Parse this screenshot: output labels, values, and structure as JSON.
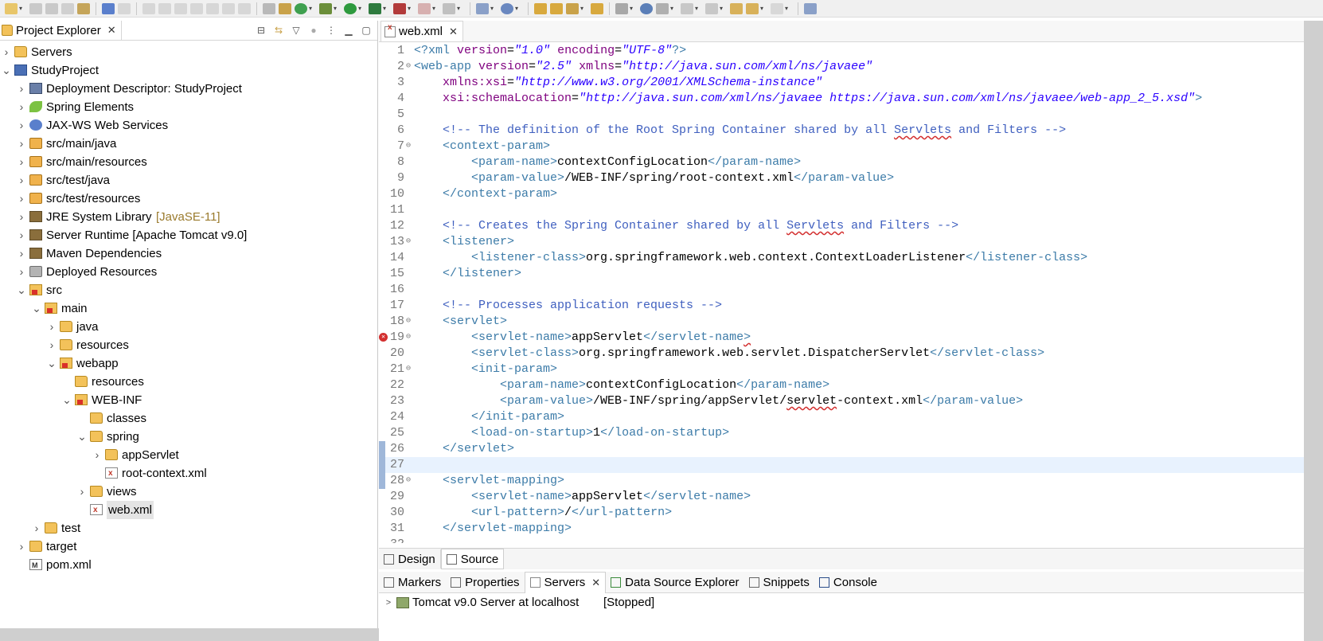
{
  "project_explorer": {
    "tab_label": "Project Explorer",
    "tree": [
      {
        "label": "Servers",
        "depth": 0,
        "twisty": "collapsed",
        "icon": "folder"
      },
      {
        "label": "StudyProject",
        "depth": 0,
        "twisty": "expanded",
        "icon": "project"
      },
      {
        "label": "Deployment Descriptor: StudyProject",
        "depth": 1,
        "twisty": "collapsed",
        "icon": "dd"
      },
      {
        "label": "Spring Elements",
        "depth": 1,
        "twisty": "collapsed",
        "icon": "leaf"
      },
      {
        "label": "JAX-WS Web Services",
        "depth": 1,
        "twisty": "collapsed",
        "icon": "ws"
      },
      {
        "label": "src/main/java",
        "depth": 1,
        "twisty": "collapsed",
        "icon": "pkgfolder"
      },
      {
        "label": "src/main/resources",
        "depth": 1,
        "twisty": "collapsed",
        "icon": "pkgfolder"
      },
      {
        "label": "src/test/java",
        "depth": 1,
        "twisty": "collapsed",
        "icon": "pkgfolder"
      },
      {
        "label": "src/test/resources",
        "depth": 1,
        "twisty": "collapsed",
        "icon": "pkgfolder"
      },
      {
        "label": "JRE System Library",
        "decoration": "[JavaSE-11]",
        "depth": 1,
        "twisty": "collapsed",
        "icon": "lib"
      },
      {
        "label": "Server Runtime [Apache Tomcat v9.0]",
        "depth": 1,
        "twisty": "collapsed",
        "icon": "lib"
      },
      {
        "label": "Maven Dependencies",
        "depth": 1,
        "twisty": "collapsed",
        "icon": "lib"
      },
      {
        "label": "Deployed Resources",
        "depth": 1,
        "twisty": "collapsed",
        "icon": "deployed"
      },
      {
        "label": "src",
        "depth": 1,
        "twisty": "expanded",
        "icon": "srcfolder"
      },
      {
        "label": "main",
        "depth": 2,
        "twisty": "expanded",
        "icon": "srcfolder"
      },
      {
        "label": "java",
        "depth": 3,
        "twisty": "collapsed",
        "icon": "folder"
      },
      {
        "label": "resources",
        "depth": 3,
        "twisty": "collapsed",
        "icon": "folder"
      },
      {
        "label": "webapp",
        "depth": 3,
        "twisty": "expanded",
        "icon": "srcfolder"
      },
      {
        "label": "resources",
        "depth": 4,
        "twisty": "none",
        "icon": "folder"
      },
      {
        "label": "WEB-INF",
        "depth": 4,
        "twisty": "expanded",
        "icon": "srcfolder"
      },
      {
        "label": "classes",
        "depth": 5,
        "twisty": "none",
        "icon": "folder"
      },
      {
        "label": "spring",
        "depth": 5,
        "twisty": "expanded",
        "icon": "folder"
      },
      {
        "label": "appServlet",
        "depth": 6,
        "twisty": "collapsed",
        "icon": "folder"
      },
      {
        "label": "root-context.xml",
        "depth": 6,
        "twisty": "none",
        "icon": "xmlfile"
      },
      {
        "label": "views",
        "depth": 5,
        "twisty": "collapsed",
        "icon": "folder"
      },
      {
        "label": "web.xml",
        "depth": 5,
        "twisty": "none",
        "icon": "xmlfile",
        "selected": true
      },
      {
        "label": "test",
        "depth": 2,
        "twisty": "collapsed",
        "icon": "folder"
      },
      {
        "label": "target",
        "depth": 1,
        "twisty": "collapsed",
        "icon": "folder"
      },
      {
        "label": "pom.xml",
        "depth": 1,
        "twisty": "none",
        "icon": "pom"
      }
    ]
  },
  "editor": {
    "tab_label": "web.xml",
    "bottom_tabs": [
      "Design",
      "Source"
    ],
    "active_bottom_tab": "Source",
    "current_line": 27,
    "error_line": 19,
    "lines": [
      {
        "n": "1",
        "fold": "",
        "segs": [
          [
            "pi",
            "<?xml "
          ],
          [
            "attr",
            "version"
          ],
          [
            "txt",
            "="
          ],
          [
            "str",
            "\"1.0\""
          ],
          [
            "txt",
            " "
          ],
          [
            "attr",
            "encoding"
          ],
          [
            "txt",
            "="
          ],
          [
            "str",
            "\"UTF-8\""
          ],
          [
            "pi",
            "?>"
          ]
        ]
      },
      {
        "n": "2",
        "fold": "⊖",
        "segs": [
          [
            "tag",
            "<web-app "
          ],
          [
            "attr",
            "version"
          ],
          [
            "txt",
            "="
          ],
          [
            "str",
            "\"2.5\""
          ],
          [
            "txt",
            " "
          ],
          [
            "attr",
            "xmlns"
          ],
          [
            "txt",
            "="
          ],
          [
            "str",
            "\"http://java.sun.com/xml/ns/javaee\""
          ]
        ]
      },
      {
        "n": "3",
        "fold": "",
        "segs": [
          [
            "txt",
            "    "
          ],
          [
            "attr",
            "xmlns:xsi"
          ],
          [
            "txt",
            "="
          ],
          [
            "str",
            "\"http://www.w3.org/2001/XMLSchema-instance\""
          ]
        ]
      },
      {
        "n": "4",
        "fold": "",
        "segs": [
          [
            "txt",
            "    "
          ],
          [
            "attr",
            "xsi:schemaLocation"
          ],
          [
            "txt",
            "="
          ],
          [
            "str",
            "\"http://java.sun.com/xml/ns/javaee https://java.sun.com/xml/ns/javaee/web-app_2_5.xsd\""
          ],
          [
            "tag",
            ">"
          ]
        ]
      },
      {
        "n": "5",
        "fold": "",
        "segs": []
      },
      {
        "n": "6",
        "fold": "",
        "segs": [
          [
            "com",
            "    <!-- The definition of the Root Spring Container shared by all "
          ],
          [
            "comsq",
            "Servlets"
          ],
          [
            "com",
            " and Filters -->"
          ]
        ]
      },
      {
        "n": "7",
        "fold": "⊖",
        "segs": [
          [
            "tag",
            "    <context-param>"
          ]
        ]
      },
      {
        "n": "8",
        "fold": "",
        "segs": [
          [
            "tag",
            "        <param-name>"
          ],
          [
            "txt",
            "contextConfigLocation"
          ],
          [
            "tag",
            "</param-name>"
          ]
        ]
      },
      {
        "n": "9",
        "fold": "",
        "segs": [
          [
            "tag",
            "        <param-value>"
          ],
          [
            "txt",
            "/WEB-INF/spring/root-context.xml"
          ],
          [
            "tag",
            "</param-value>"
          ]
        ]
      },
      {
        "n": "10",
        "fold": "",
        "segs": [
          [
            "tag",
            "    </context-param>"
          ]
        ]
      },
      {
        "n": "11",
        "fold": "",
        "segs": []
      },
      {
        "n": "12",
        "fold": "",
        "segs": [
          [
            "com",
            "    <!-- Creates the Spring Container shared by all "
          ],
          [
            "comsq",
            "Servlets"
          ],
          [
            "com",
            " and Filters -->"
          ]
        ]
      },
      {
        "n": "13",
        "fold": "⊖",
        "segs": [
          [
            "tag",
            "    <listener>"
          ]
        ]
      },
      {
        "n": "14",
        "fold": "",
        "segs": [
          [
            "tag",
            "        <listener-class>"
          ],
          [
            "txt",
            "org.springframework.web.context.ContextLoaderListener"
          ],
          [
            "tag",
            "</listener-class>"
          ]
        ]
      },
      {
        "n": "15",
        "fold": "",
        "segs": [
          [
            "tag",
            "    </listener>"
          ]
        ]
      },
      {
        "n": "16",
        "fold": "",
        "segs": []
      },
      {
        "n": "17",
        "fold": "",
        "segs": [
          [
            "com",
            "    <!-- Processes application requests -->"
          ]
        ]
      },
      {
        "n": "18",
        "fold": "⊖",
        "segs": [
          [
            "tag",
            "    <servlet>"
          ]
        ]
      },
      {
        "n": "19",
        "fold": "⊖",
        "segs": [
          [
            "tag",
            "        <servlet-name>"
          ],
          [
            "txt",
            "appServlet"
          ],
          [
            "tag",
            "</servlet-name"
          ],
          [
            "tagsq",
            ">"
          ]
        ]
      },
      {
        "n": "20",
        "fold": "",
        "segs": [
          [
            "tag",
            "        <servlet-class>"
          ],
          [
            "txt",
            "org.springframework.web.servlet.DispatcherServlet"
          ],
          [
            "tag",
            "</servlet-class>"
          ]
        ]
      },
      {
        "n": "21",
        "fold": "⊖",
        "segs": [
          [
            "tag",
            "        <init-param>"
          ]
        ]
      },
      {
        "n": "22",
        "fold": "",
        "segs": [
          [
            "tag",
            "            <param-name>"
          ],
          [
            "txt",
            "contextConfigLocation"
          ],
          [
            "tag",
            "</param-name>"
          ]
        ]
      },
      {
        "n": "23",
        "fold": "",
        "segs": [
          [
            "tag",
            "            <param-value>"
          ],
          [
            "txt",
            "/WEB-INF/spring/appServlet/"
          ],
          [
            "txtsq",
            "servlet"
          ],
          [
            "txt",
            "-context.xml"
          ],
          [
            "tag",
            "</param-value>"
          ]
        ]
      },
      {
        "n": "24",
        "fold": "",
        "segs": [
          [
            "tag",
            "        </init-param>"
          ]
        ]
      },
      {
        "n": "25",
        "fold": "",
        "segs": [
          [
            "tag",
            "        <load-on-startup>"
          ],
          [
            "txt",
            "1"
          ],
          [
            "tag",
            "</load-on-startup>"
          ]
        ]
      },
      {
        "n": "26",
        "fold": "",
        "segs": [
          [
            "tag",
            "    </servlet>"
          ]
        ]
      },
      {
        "n": "27",
        "fold": "",
        "segs": []
      },
      {
        "n": "28",
        "fold": "⊖",
        "segs": [
          [
            "tag",
            "    <servlet-mapping>"
          ]
        ]
      },
      {
        "n": "29",
        "fold": "",
        "segs": [
          [
            "tag",
            "        <servlet-name>"
          ],
          [
            "txt",
            "appServlet"
          ],
          [
            "tag",
            "</servlet-name>"
          ]
        ]
      },
      {
        "n": "30",
        "fold": "",
        "segs": [
          [
            "tag",
            "        <url-pattern>"
          ],
          [
            "txt",
            "/"
          ],
          [
            "tag",
            "</url-pattern>"
          ]
        ]
      },
      {
        "n": "31",
        "fold": "",
        "segs": [
          [
            "tag",
            "    </servlet-mapping>"
          ]
        ]
      },
      {
        "n": "32",
        "fold": "",
        "segs": []
      }
    ]
  },
  "bottom_views": {
    "tabs": [
      "Markers",
      "Properties",
      "Servers",
      "Data Source Explorer",
      "Snippets",
      "Console"
    ],
    "active_tab": "Servers",
    "server_entry": "Tomcat v9.0 Server at localhost",
    "server_state": "[Stopped]"
  },
  "colors": {
    "tag": "#3c7ba8",
    "attribute": "#7f007f",
    "string": "#2a00ff",
    "comment": "#3f5fbf",
    "current_line": "#e8f2fe",
    "error": "#d32f2f"
  }
}
